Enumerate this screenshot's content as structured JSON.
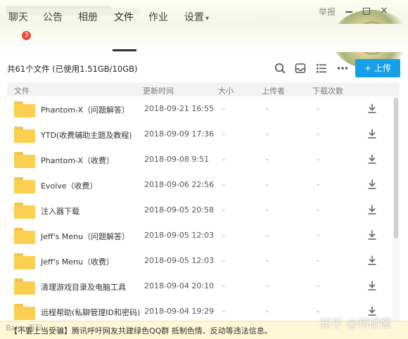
{
  "window": {
    "report_label": "举报"
  },
  "tabs": [
    {
      "label": "聊天",
      "badge": "3"
    },
    {
      "label": "公告"
    },
    {
      "label": "相册"
    },
    {
      "label": "文件",
      "active": true
    },
    {
      "label": "作业"
    },
    {
      "label": "设置",
      "dropdown_caret": "▾"
    }
  ],
  "toolbar": {
    "summary": "共61个文件 (已使用1.51GB/10GB)",
    "upload_label": "上传",
    "icons": [
      "search-icon",
      "inbox-icon",
      "list-icon",
      "more-icon"
    ]
  },
  "table": {
    "columns": [
      "文件",
      "更新时间",
      "大小",
      "上传者",
      "下载次数"
    ],
    "rows": [
      {
        "name": "Phantom-X（问题解答）",
        "time": "2018-09-21 16:55",
        "size": "-",
        "uploader": "-",
        "downloads": "-"
      },
      {
        "name": "YTD(收费辅助主题及教程)",
        "time": "2018-09-09 17:36",
        "size": "-",
        "uploader": "-",
        "downloads": "-"
      },
      {
        "name": "Phantom-X（收费）",
        "time": "2018-09-08 9:51",
        "size": "-",
        "uploader": "-",
        "downloads": "-"
      },
      {
        "name": "Evolve（收费）",
        "time": "2018-09-06 22:56",
        "size": "-",
        "uploader": "-",
        "downloads": "-"
      },
      {
        "name": "注入器下载",
        "time": "2018-09-05 20:58",
        "size": "-",
        "uploader": "-",
        "downloads": "-"
      },
      {
        "name": "Jeff's Menu（问题解答）",
        "time": "2018-09-05 12:03",
        "size": "-",
        "uploader": "-",
        "downloads": "-"
      },
      {
        "name": "Jeff's Menu（收费）",
        "time": "2018-09-05 12:03",
        "size": "-",
        "uploader": "-",
        "downloads": "-"
      },
      {
        "name": "清理游戏目录及电脑工具",
        "time": "2018-09-04 20:10",
        "size": "-",
        "uploader": "-",
        "downloads": "-"
      },
      {
        "name": "远程帮助(私聊管理ID和密码)",
        "time": "2018-09-04 19:29",
        "size": "-",
        "uploader": "-",
        "downloads": "-"
      }
    ]
  },
  "notice": "【不要上当受骗】腾讯呼吁网友共建绿色QQ群 抵制色情、反动等违法信息。",
  "watermarks": {
    "left": "Baidu百科",
    "right": "知乎 @邦硬酱"
  },
  "colors": {
    "accent": "#16a0ea",
    "badge": "#e94b3c",
    "folder": "#fbcf4f"
  }
}
